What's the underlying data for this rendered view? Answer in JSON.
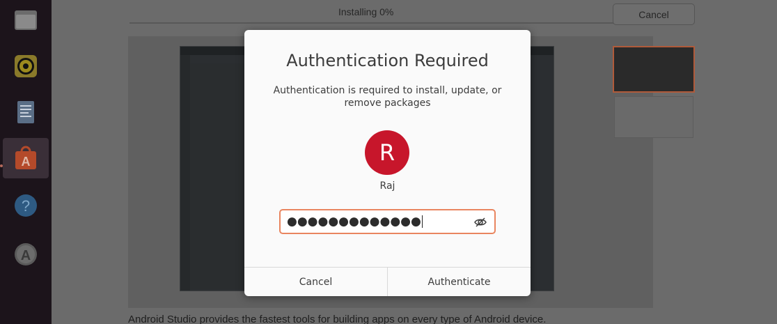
{
  "background_window": {
    "status": "Installing 0%",
    "cancel_label": "Cancel",
    "description": "Android Studio provides the fastest tools for building apps on every type of Android device."
  },
  "dialog": {
    "title": "Authentication Required",
    "message": "Authentication is required to install, update, or remove packages",
    "avatar_initial": "R",
    "user_name": "Raj",
    "password_mask": "●●●●●●●●●●●●●",
    "cancel_label": "Cancel",
    "authenticate_label": "Authenticate"
  },
  "dock": {
    "items": [
      "files-icon",
      "rhythmbox-icon",
      "text-editor-icon",
      "software-icon",
      "help-icon",
      "software-updater-icon"
    ]
  },
  "colors": {
    "avatar_bg": "#c7162b",
    "field_focus": "#e9855f",
    "accent": "#b05a3a"
  }
}
